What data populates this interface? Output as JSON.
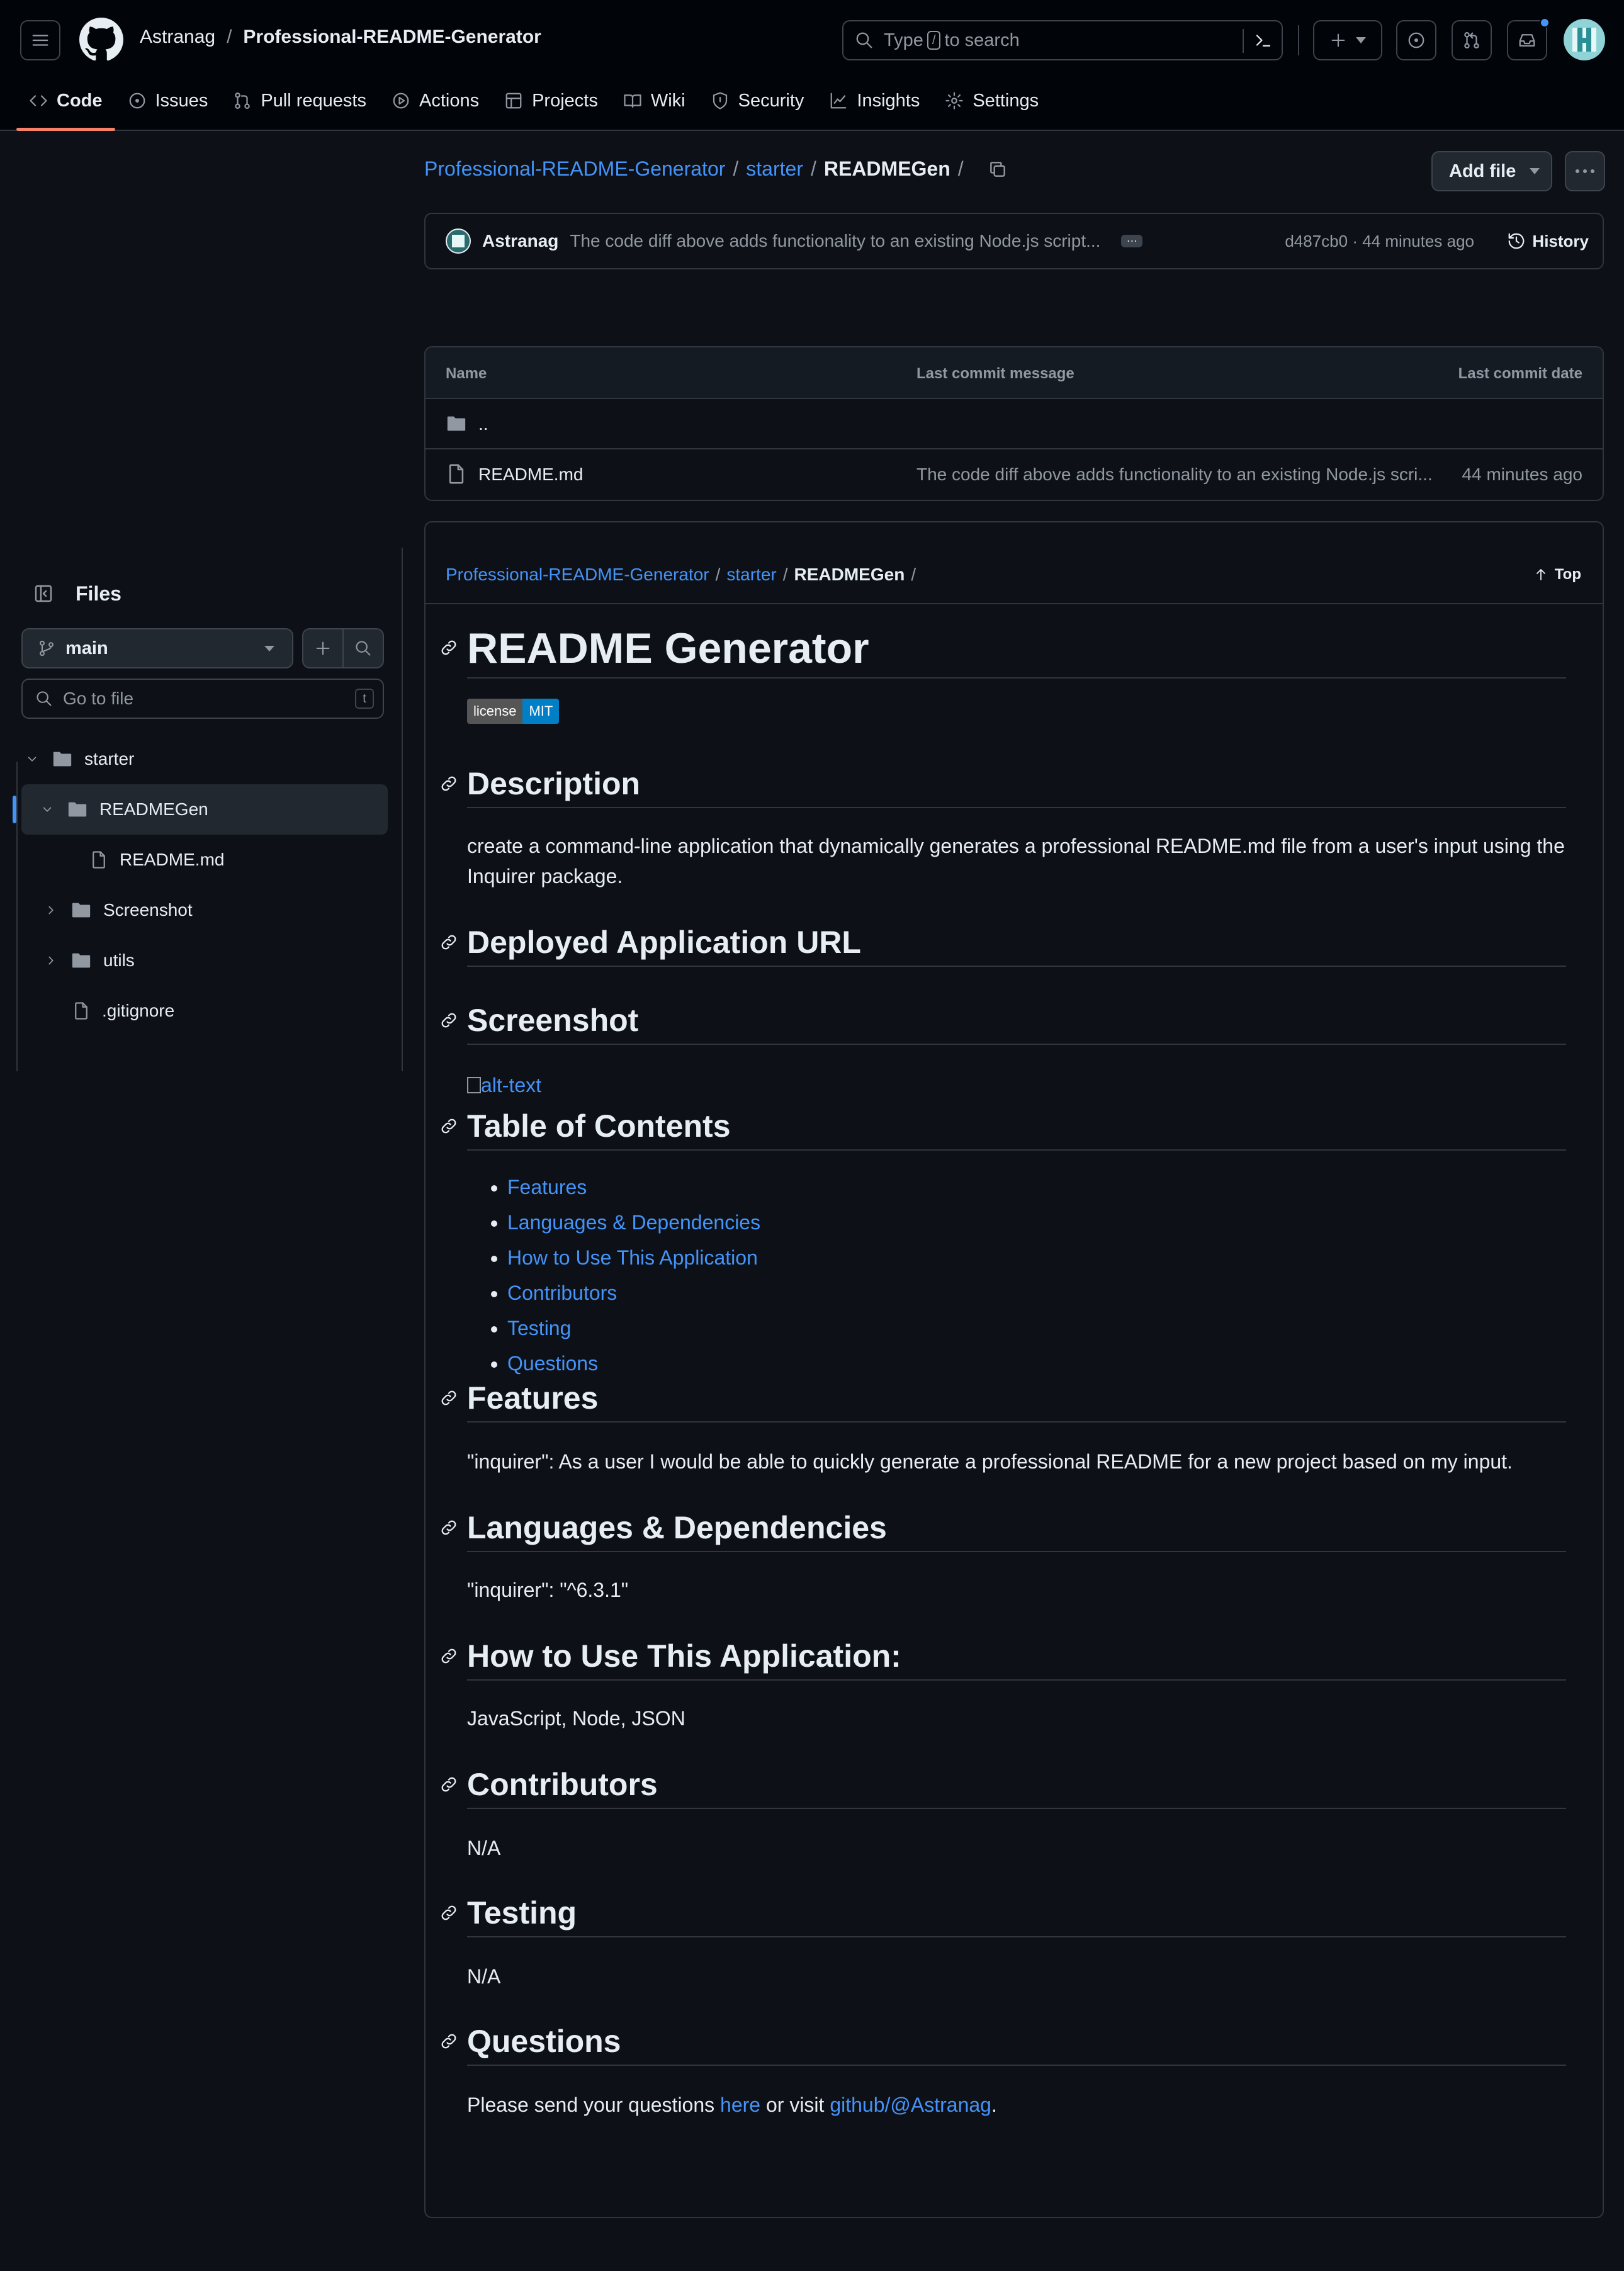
{
  "header": {
    "owner": "Astranag",
    "separator": "/",
    "repo": "Professional-README-Generator",
    "search_placeholder_pre": "Type",
    "search_key": "/",
    "search_placeholder_post": "to search"
  },
  "tabs": [
    {
      "label": "Code",
      "icon": "code-icon"
    },
    {
      "label": "Issues",
      "icon": "issue-icon"
    },
    {
      "label": "Pull requests",
      "icon": "pull-request-icon"
    },
    {
      "label": "Actions",
      "icon": "play-icon"
    },
    {
      "label": "Projects",
      "icon": "table-icon"
    },
    {
      "label": "Wiki",
      "icon": "book-icon"
    },
    {
      "label": "Security",
      "icon": "shield-icon"
    },
    {
      "label": "Insights",
      "icon": "graph-icon"
    },
    {
      "label": "Settings",
      "icon": "gear-icon"
    }
  ],
  "breadcrumb": {
    "repo": "Professional-README-Generator",
    "folder": "starter",
    "current": "README​Gen",
    "sep": "/"
  },
  "actions": {
    "add_file": "Add file"
  },
  "commit": {
    "author": "Astranag",
    "message": "The code diff above adds functionality to an existing Node.js script...",
    "sha_time": "d487cb0 · 44 minutes ago",
    "history": "History"
  },
  "file_table": {
    "headers": [
      "Name",
      "Last commit message",
      "Last commit date"
    ],
    "parent": "..",
    "rows": [
      {
        "name": "README.md",
        "message": "The code diff above adds functionality to an existing Node.js scri...",
        "date": "44 minutes ago"
      }
    ]
  },
  "sidebar": {
    "title": "Files",
    "branch": "main",
    "go_to_file": "Go to file",
    "go_to_key": "t",
    "tree": [
      {
        "label": "starter",
        "type": "folder",
        "depth": 0,
        "expanded": true
      },
      {
        "label": "READMEGen",
        "type": "folder",
        "depth": 1,
        "expanded": true,
        "selected": true
      },
      {
        "label": "README.md",
        "type": "file",
        "depth": 2
      },
      {
        "label": "Screenshot",
        "type": "folder",
        "depth": 1,
        "expanded": false
      },
      {
        "label": "utils",
        "type": "folder",
        "depth": 1,
        "expanded": false
      },
      {
        "label": ".gitignore",
        "type": "file",
        "depth": 1
      }
    ]
  },
  "readme": {
    "crumb_repo": "Professional-README-Generator",
    "crumb_folder": "starter",
    "crumb_current": "READMEGen",
    "top": "Top",
    "title": "README Generator",
    "badge_left": "license",
    "badge_right": "MIT",
    "desc_h": "Description",
    "desc_p": "create a command-line application that dynamically generates a professional README.md file from a user's input using the Inquirer package.",
    "deploy_h": "Deployed Application URL",
    "shot_h": "Screenshot",
    "shot_alt": "alt-text",
    "toc_h": "Table of Contents",
    "toc": [
      "Features",
      "Languages & Dependencies",
      "How to Use This Application",
      "Contributors",
      "Testing",
      "Questions"
    ],
    "feat_h": "Features",
    "feat_p": "\"inquirer\": As a user I would be able to quickly generate a professional README for a new project based on my input.",
    "lang_h": "Languages & Dependencies",
    "lang_p": "\"inquirer\": \"^6.3.1\"",
    "how_h": "How to Use This Application:",
    "how_p": "JavaScript, Node, JSON",
    "contrib_h": "Contributors",
    "contrib_p": "N/A",
    "test_h": "Testing",
    "test_p": "N/A",
    "q_h": "Questions",
    "q_pre": "Please send your questions",
    "q_link1": "here",
    "q_mid": "or visit",
    "q_link2": "github/@Astranag",
    "q_end": "."
  }
}
